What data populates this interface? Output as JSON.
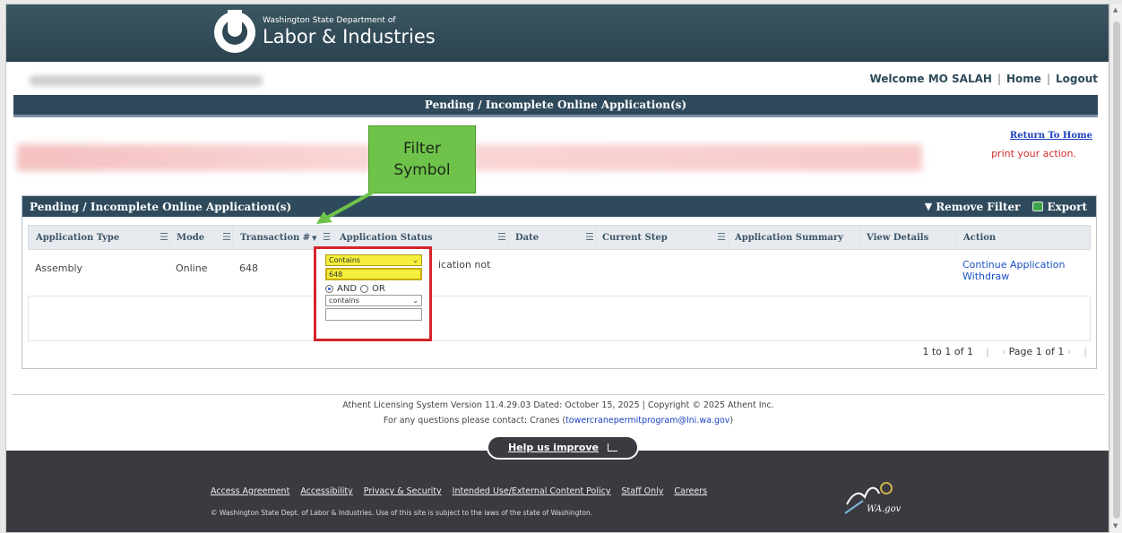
{
  "header": {
    "agency_small": "Washington State Department of",
    "agency_big": "Labor & Industries"
  },
  "userbar": {
    "welcome": "Welcome MO SALAH",
    "home": "Home",
    "logout": "Logout"
  },
  "page_title": "Pending / Incomplete Online Application(s)",
  "return_home": "Return To Home",
  "red_message": "print your action.",
  "callout": {
    "line1": "Filter",
    "line2": "Symbol"
  },
  "grid": {
    "title": "Pending / Incomplete Online Application(s)",
    "remove_filter": "Remove Filter",
    "export": "Export",
    "columns": [
      "Application Type",
      "Mode",
      "Transaction #",
      "Application Status",
      "Date",
      "Current Step",
      "Application Summary",
      "View Details",
      "Action"
    ],
    "row": {
      "type": "Assembly",
      "mode": "Online",
      "transaction": "648",
      "status": "ication not",
      "actions": [
        "Continue Application",
        "Withdraw"
      ]
    },
    "pager": {
      "range": "1 to 1 of 1",
      "page": "Page 1 of 1"
    }
  },
  "filter": {
    "op1": "Contains",
    "value1": "648",
    "and_label": "AND",
    "or_label": "OR",
    "op2": "contains",
    "value2": ""
  },
  "footer": {
    "version": "Athent Licensing System Version 11.4.29.03 Dated: October 15, 2025 | Copyright © 2025 Athent Inc.",
    "contact_prefix": "For any questions please contact: Cranes (",
    "contact_email": "towercranepermitprogram@lni.wa.gov",
    "contact_suffix": ")",
    "improve": "Help us improve",
    "links": [
      "Access Agreement",
      "Accessibility",
      "Privacy & Security",
      "Intended Use/External Content Policy",
      "Staff Only",
      "Careers"
    ],
    "copyright": "© Washington State Dept. of Labor & Industries. Use of this site is subject to the laws of the state of Washington.",
    "wagov": "WA.gov"
  }
}
